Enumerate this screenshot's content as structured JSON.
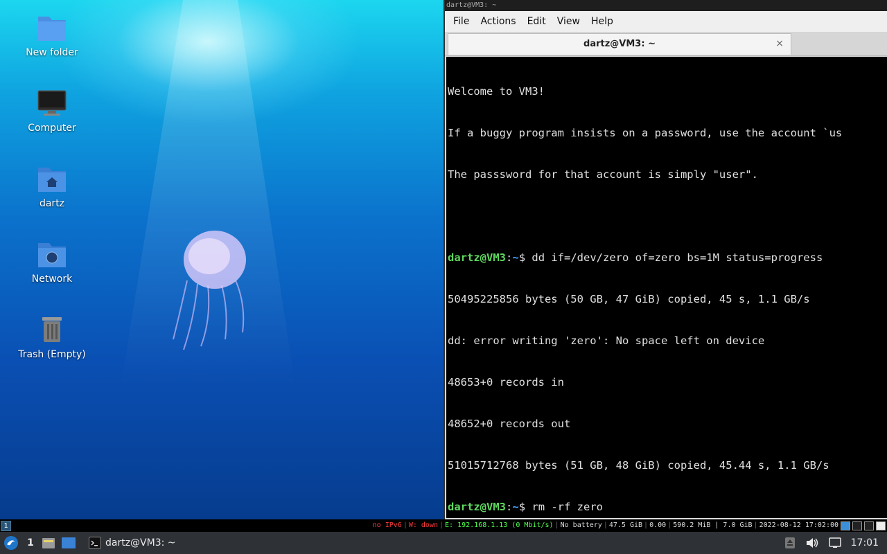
{
  "desktop": {
    "icons": [
      {
        "label": "New folder",
        "icon": "folder-icon"
      },
      {
        "label": "Computer",
        "icon": "computer-icon"
      },
      {
        "label": "dartz",
        "icon": "home-folder-icon"
      },
      {
        "label": "Network",
        "icon": "network-folder-icon"
      },
      {
        "label": "Trash (Empty)",
        "icon": "trash-icon"
      }
    ]
  },
  "terminal": {
    "wm_title": "dartz@VM3: ~",
    "menu": [
      "File",
      "Actions",
      "Edit",
      "View",
      "Help"
    ],
    "tab_title": "dartz@VM3: ~",
    "tab_close": "×",
    "prompt_user": "dartz@VM3",
    "prompt_sep": ":",
    "prompt_path": "~",
    "prompt_sym": "$ ",
    "lines": {
      "l1": "Welcome to VM3!",
      "l2": "If a buggy program insists on a password, use the account `us",
      "l3": "The passsword for that account is simply \"user\".",
      "cmd1": "dd if=/dev/zero of=zero bs=1M status=progress",
      "o1": "50495225856 bytes (50 GB, 47 GiB) copied, 45 s, 1.1 GB/s",
      "o2": "dd: error writing 'zero': No space left on device",
      "o3": "48653+0 records in",
      "o4": "48652+0 records out",
      "o5": "51015712768 bytes (51 GB, 48 GiB) copied, 45.44 s, 1.1 GB/s",
      "cmd2": "rm -rf zero"
    }
  },
  "statusbar": {
    "workspace": "1",
    "ipv6": "no IPv6",
    "wifi": "W: down",
    "ethernet": "E: 192.168.1.13 (0 Mbit/s)",
    "battery": "No battery",
    "disk": "47.5 GiB",
    "load": "0.00",
    "memory": "590.2 MiB | 7.0 GiB",
    "datetime": "2022-08-12 17:02:00",
    "separator": "|"
  },
  "taskbar": {
    "workspace": "1",
    "task_label": "dartz@VM3: ~",
    "clock": "17:01"
  },
  "colors": {
    "prompt_user": "#5fd75f",
    "prompt_path": "#4aa3ff",
    "status_red": "#ff3b3b",
    "status_green": "#4cff4c"
  }
}
